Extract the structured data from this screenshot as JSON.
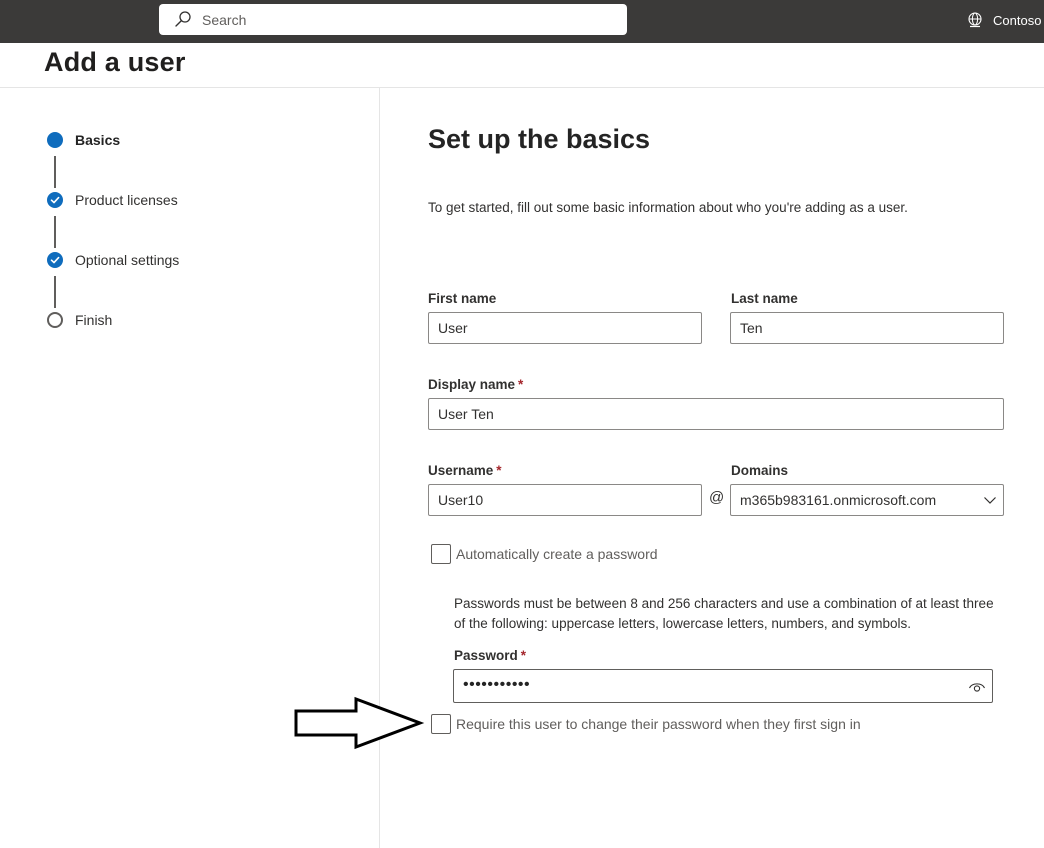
{
  "topbar": {
    "search_placeholder": "Search",
    "tenant_name": "Contoso",
    "search_icon": "search-icon",
    "tenant_icon": "globe-icon"
  },
  "page": {
    "title": "Add a user"
  },
  "wizard": {
    "steps": [
      {
        "label": "Basics",
        "state": "current"
      },
      {
        "label": "Product licenses",
        "state": "completed"
      },
      {
        "label": "Optional settings",
        "state": "completed"
      },
      {
        "label": "Finish",
        "state": "pending"
      }
    ]
  },
  "form": {
    "title": "Set up the basics",
    "intro": "To get started, fill out some basic information about who you're adding as a user.",
    "first_name": {
      "label": "First name",
      "value": "User"
    },
    "last_name": {
      "label": "Last name",
      "value": "Ten"
    },
    "display_name": {
      "label": "Display name",
      "required_mark": "*",
      "value": "User Ten"
    },
    "username": {
      "label": "Username",
      "required_mark": "*",
      "value": "User10"
    },
    "at_sign": "@",
    "domains": {
      "label": "Domains",
      "value": "m365b983161.onmicrosoft.com"
    },
    "auto_password": {
      "label": "Automatically create a password",
      "checked": false
    },
    "password_help": "Passwords must be between 8 and 256 characters and use a combination of at least three of the following: uppercase letters, lowercase letters, numbers, and symbols.",
    "password": {
      "label": "Password",
      "required_mark": "*",
      "masked_value": "•••••••••••"
    },
    "require_change": {
      "label": "Require this user to change their password when they first sign in",
      "checked": false
    }
  },
  "colors": {
    "topbar": "#3b3a39",
    "accent": "#0f6cbd",
    "required": "#a4262c"
  }
}
